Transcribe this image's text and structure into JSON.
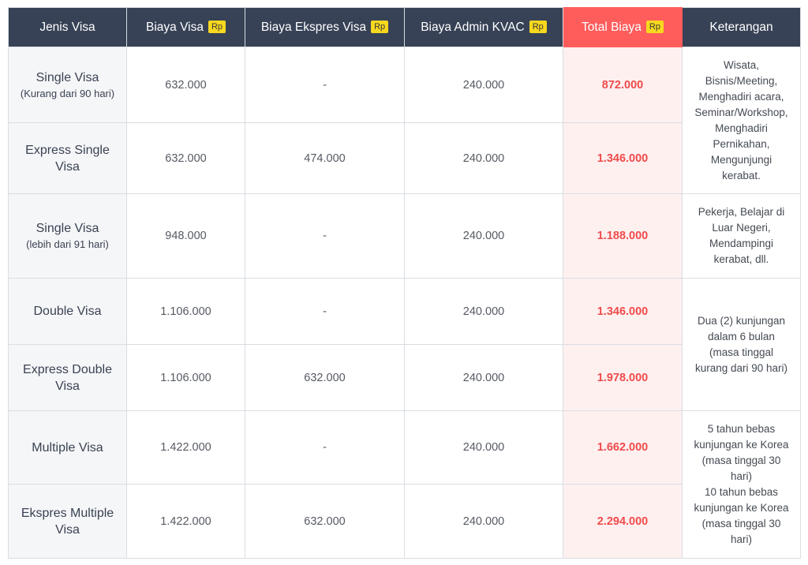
{
  "headers": [
    {
      "label": "Jenis Visa",
      "badge": ""
    },
    {
      "label": "Biaya Visa",
      "badge": "Rp"
    },
    {
      "label": "Biaya Ekspres Visa",
      "badge": "Rp"
    },
    {
      "label": "Biaya Admin KVAC",
      "badge": "Rp"
    },
    {
      "label": "Total Biaya",
      "badge": "Rp"
    },
    {
      "label": "Keterangan",
      "badge": ""
    }
  ],
  "rows": [
    {
      "type": "Single Visa",
      "sub": "(Kurang dari 90 hari)",
      "visa": "632.000",
      "express": "-",
      "admin": "240.000",
      "total": "872.000"
    },
    {
      "type": "Express Single Visa",
      "sub": "",
      "visa": "632.000",
      "express": "474.000",
      "admin": "240.000",
      "total": "1.346.000"
    },
    {
      "type": "Single Visa",
      "sub": "(lebih dari 91 hari)",
      "visa": "948.000",
      "express": "-",
      "admin": "240.000",
      "total": "1.188.000"
    },
    {
      "type": "Double Visa",
      "sub": "",
      "visa": "1.106.000",
      "express": "-",
      "admin": "240.000",
      "total": "1.346.000"
    },
    {
      "type": "Express Double Visa",
      "sub": "",
      "visa": "1.106.000",
      "express": "632.000",
      "admin": "240.000",
      "total": "1.978.000"
    },
    {
      "type": "Multiple Visa",
      "sub": "",
      "visa": "1.422.000",
      "express": "-",
      "admin": "240.000",
      "total": "1.662.000"
    },
    {
      "type": "Ekspres Multiple Visa",
      "sub": "",
      "visa": "1.422.000",
      "express": "632.000",
      "admin": "240.000",
      "total": "2.294.000"
    }
  ],
  "notes": {
    "single_short": "Wisata,\nBisnis/Meeting,\nMenghadiri acara,\nSeminar/Workshop,\nMenghadiri\nPernikahan,\nMengunjungi\nkerabat.",
    "single_long": "Pekerja, Belajar di\nLuar Negeri,\nMendampingi\nkerabat, dll.",
    "double": "Dua (2) kunjungan\ndalam 6 bulan\n(masa tinggal\nkurang dari 90 hari)",
    "multiple_5": "5 tahun bebas\nkunjungan ke Korea\n(masa tinggal 30\nhari)",
    "multiple_10": "10 tahun bebas\nkunjungan ke Korea\n(masa tinggal 30\nhari)"
  }
}
